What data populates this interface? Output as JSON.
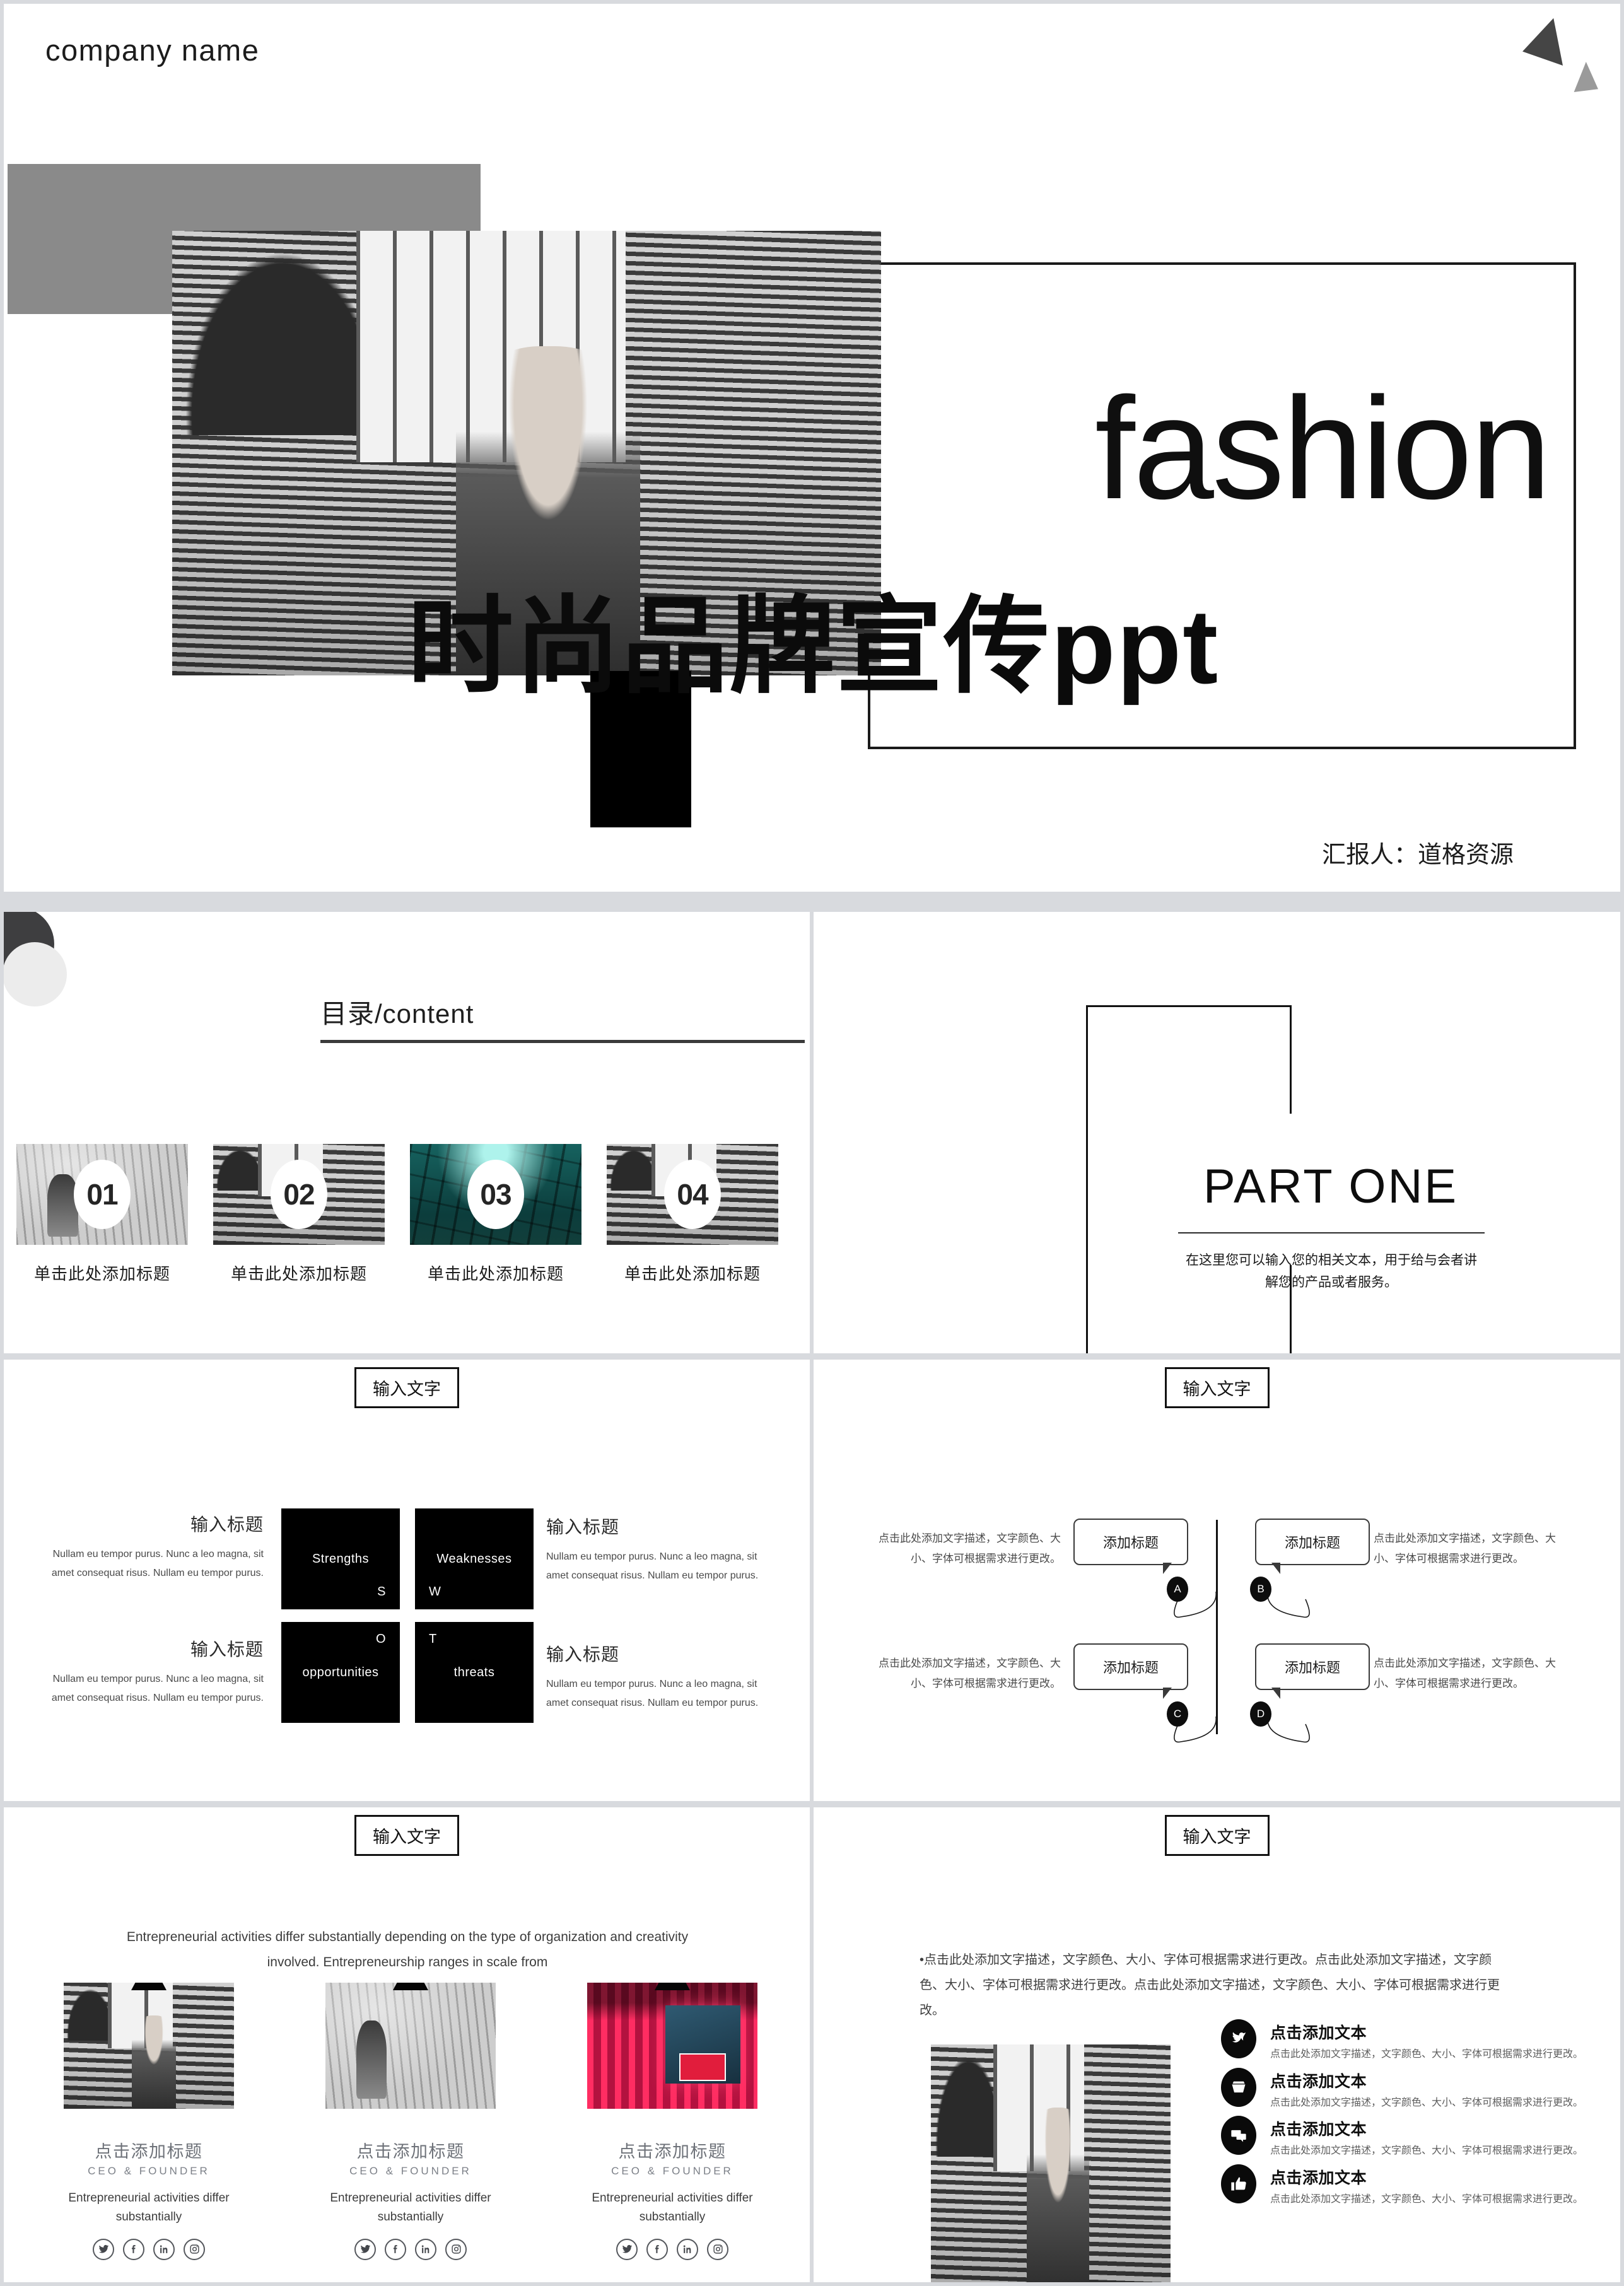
{
  "cover": {
    "company_name": "company name",
    "fashion_word": "fashion",
    "cn_title": "时尚品牌宣传ppt",
    "presenter": "汇报人：道格资源"
  },
  "content_slide": {
    "heading": "目录/content",
    "items": [
      {
        "num": "01",
        "caption": "单击此处添加标题"
      },
      {
        "num": "02",
        "caption": "单击此处添加标题"
      },
      {
        "num": "03",
        "caption": "单击此处添加标题"
      },
      {
        "num": "04",
        "caption": "单击此处添加标题"
      }
    ]
  },
  "part_slide": {
    "title": "PART ONE",
    "desc": "在这里您可以输入您的相关文本，用于给与会者讲解您的产品或者服务。"
  },
  "swot_slide": {
    "header": "输入文字",
    "cells": [
      {
        "name": "Strengths",
        "mark": "S"
      },
      {
        "name": "Weaknesses",
        "mark": "W"
      },
      {
        "name": "opportunities",
        "mark": "O"
      },
      {
        "name": "threats",
        "mark": "T"
      }
    ],
    "blocks": [
      {
        "title": "输入标题",
        "desc": "Nullam eu tempor purus. Nunc a leo magna, sit amet consequat risus. Nullam eu tempor purus."
      },
      {
        "title": "输入标题",
        "desc": "Nullam eu tempor purus. Nunc a leo magna, sit amet consequat risus. Nullam eu tempor purus."
      },
      {
        "title": "输入标题",
        "desc": "Nullam eu tempor purus. Nunc a leo magna, sit amet consequat risus. Nullam eu tempor purus."
      },
      {
        "title": "输入标题",
        "desc": "Nullam eu tempor purus. Nunc a leo magna, sit amet consequat risus. Nullam eu tempor purus."
      }
    ]
  },
  "bubble_slide": {
    "header": "输入文字",
    "bubbles": [
      {
        "label": "添加标题",
        "node": "A",
        "desc": "点击此处添加文字描述，文字颜色、大小、字体可根据需求进行更改。"
      },
      {
        "label": "添加标题",
        "node": "B",
        "desc": "点击此处添加文字描述，文字颜色、大小、字体可根据需求进行更改。"
      },
      {
        "label": "添加标题",
        "node": "C",
        "desc": "点击此处添加文字描述，文字颜色、大小、字体可根据需求进行更改。"
      },
      {
        "label": "添加标题",
        "node": "D",
        "desc": "点击此处添加文字描述，文字颜色、大小、字体可根据需求进行更改。"
      }
    ]
  },
  "team_slide": {
    "header": "输入文字",
    "lead": "Entrepreneurial activities differ substantially depending on the type of organization and creativity involved. Entrepreneurship ranges in scale from",
    "cards": [
      {
        "name": "点击添加标题",
        "role": "CEO & FOUNDER",
        "desc": "Entrepreneurial activities differ substantially"
      },
      {
        "name": "点击添加标题",
        "role": "CEO & FOUNDER",
        "desc": "Entrepreneurial activities differ substantially"
      },
      {
        "name": "点击添加标题",
        "role": "CEO & FOUNDER",
        "desc": "Entrepreneurial activities differ substantially"
      }
    ],
    "socials": [
      "twitter-icon",
      "facebook-icon",
      "linkedin-icon",
      "instagram-icon"
    ]
  },
  "list_slide": {
    "header": "输入文字",
    "lead": "•点击此处添加文字描述，文字颜色、大小、字体可根据需求进行更改。点击此处添加文字描述，文字颜色、大小、字体可根据需求进行更改。点击此处添加文字描述，文字颜色、大小、字体可根据需求进行更改。",
    "items": [
      {
        "icon": "bird-icon",
        "title": "点击添加文本",
        "desc": "点击此处添加文字描述，文字颜色、大小、字体可根据需求进行更改。"
      },
      {
        "icon": "inbox-icon",
        "title": "点击添加文本",
        "desc": "点击此处添加文字描述，文字颜色、大小、字体可根据需求进行更改。"
      },
      {
        "icon": "chat-icon",
        "title": "点击添加文本",
        "desc": "点击此处添加文字描述，文字颜色、大小、字体可根据需求进行更改。"
      },
      {
        "icon": "thumbs-up-icon",
        "title": "点击添加文本",
        "desc": "点击此处添加文字描述，文字颜色、大小、字体可根据需求进行更改。"
      }
    ]
  },
  "colors": {
    "ink": "#111111",
    "gray_block": "#8a8a8a",
    "gutter": "#d8dade",
    "accent_teal": "#16625f",
    "accent_neon": "#ff3b6b"
  }
}
